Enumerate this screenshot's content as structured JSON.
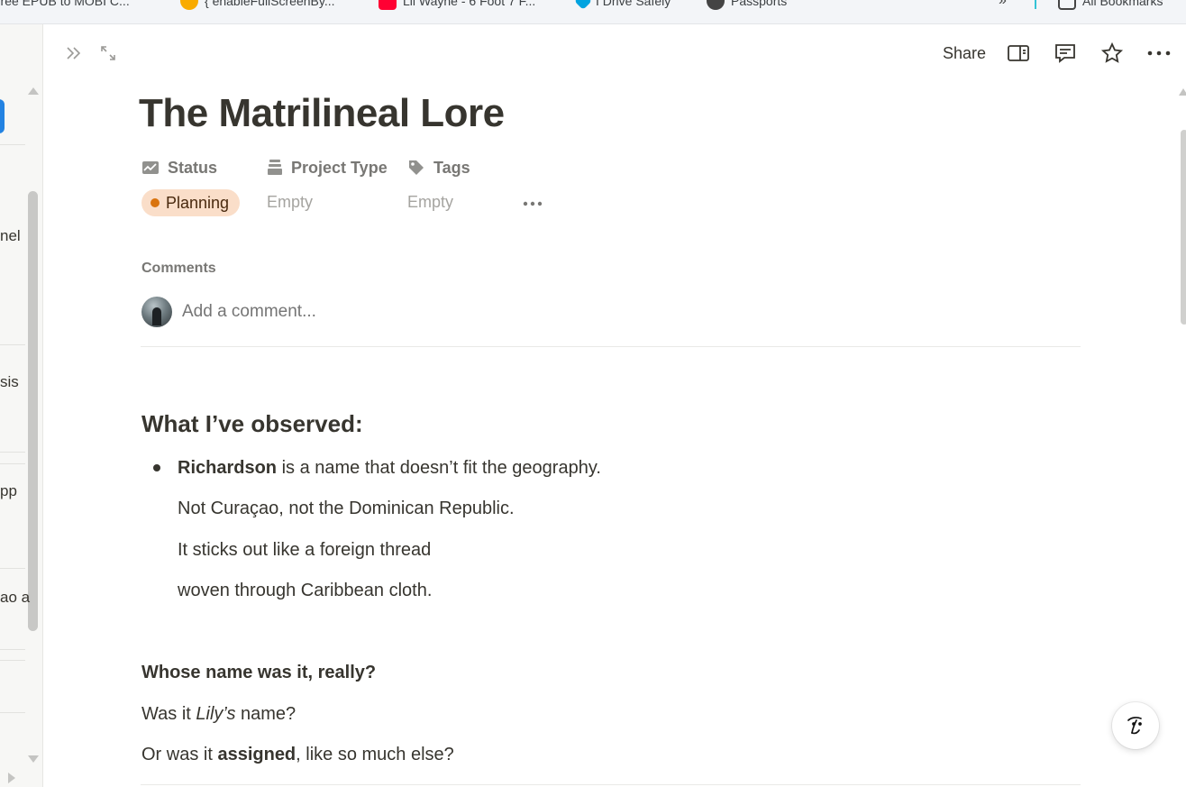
{
  "bookmarks": [
    {
      "label": "Free EPUB to MOBI C...",
      "icon": "book-icon",
      "color": "#e8710a"
    },
    {
      "label": "{ enableFullScreenBy...",
      "icon": "emoji-icon",
      "color": "#f9ab00"
    },
    {
      "label": "Lil Wayne - 6 Foot 7 F...",
      "icon": "youtube-icon",
      "color": "#ff0033"
    },
    {
      "label": "I Drive Safely",
      "icon": "idrive-icon",
      "color": "#00a3e0"
    },
    {
      "label": "Passports",
      "icon": "globe-icon",
      "color": "#444444"
    },
    {
      "label": "All Bookmarks",
      "icon": "folder-icon",
      "color": "#444444"
    }
  ],
  "sidebar": {
    "peek_items": [
      "nel",
      "sis",
      "pp",
      "ao a"
    ]
  },
  "topbar": {
    "share_label": "Share",
    "icons": [
      "sidebar-toggle-icon",
      "comment-icon",
      "star-icon",
      "more-icon"
    ]
  },
  "page": {
    "title": "The Matrilineal Lore",
    "properties": {
      "status_label": "Status",
      "project_type_label": "Project Type",
      "tags_label": "Tags",
      "status_value": "Planning",
      "status_color": "#d9730d",
      "project_type_value": "Empty",
      "tags_value": "Empty"
    },
    "comments": {
      "label": "Comments",
      "placeholder": "Add a comment..."
    },
    "body": {
      "heading": "What I’ve observed:",
      "bullet_bold": "Richardson",
      "bullet_rest": " is a name that doesn’t fit the geography.",
      "bullet_lines": [
        "Not Curaçao, not the Dominican Republic.",
        "It sticks out like a foreign thread",
        "woven through Caribbean cloth."
      ],
      "question_heading": "Whose name was it, really?",
      "q2_prefix": "Was it ",
      "q2_italic": "Lily’s",
      "q2_suffix": " name?",
      "q3_prefix": "Or was it ",
      "q3_bold": "assigned",
      "q3_suffix": ", like so much else?"
    }
  }
}
